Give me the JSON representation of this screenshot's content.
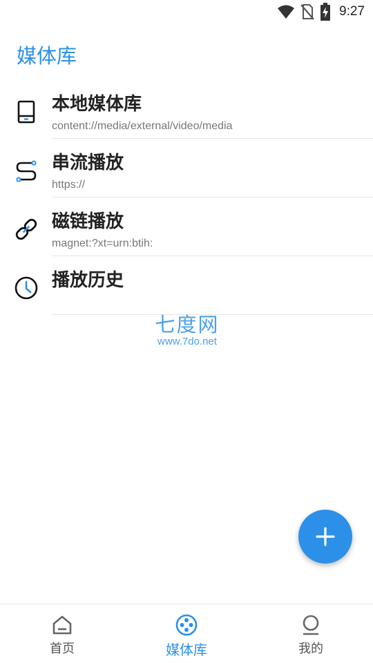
{
  "status_bar": {
    "time": "9:27",
    "icons": [
      "wifi-icon",
      "no-sim-icon",
      "battery-charging-icon"
    ]
  },
  "header": {
    "title": "媒体库"
  },
  "list": [
    {
      "title": "本地媒体库",
      "subtitle": "content://media/external/video/media",
      "icon": "tablet-device-icon"
    },
    {
      "title": "串流播放",
      "subtitle": "https://",
      "icon": "route-stream-icon"
    },
    {
      "title": "磁链播放",
      "subtitle": "magnet:?xt=urn:btih:",
      "icon": "link-icon"
    },
    {
      "title": "播放历史",
      "subtitle": "",
      "icon": "clock-icon"
    }
  ],
  "watermark": {
    "logo_text": "七度网",
    "url": "www.7do.net"
  },
  "fab": {
    "icon": "plus-icon"
  },
  "bottom_nav": [
    {
      "label": "首页",
      "icon": "home-icon",
      "active": false
    },
    {
      "label": "媒体库",
      "icon": "film-reel-icon",
      "active": true
    },
    {
      "label": "我的",
      "icon": "person-icon",
      "active": false
    }
  ],
  "colors": {
    "accent": "#2c90e8",
    "text_primary": "#222222",
    "text_secondary": "#777777",
    "divider": "#e6e6e6"
  }
}
